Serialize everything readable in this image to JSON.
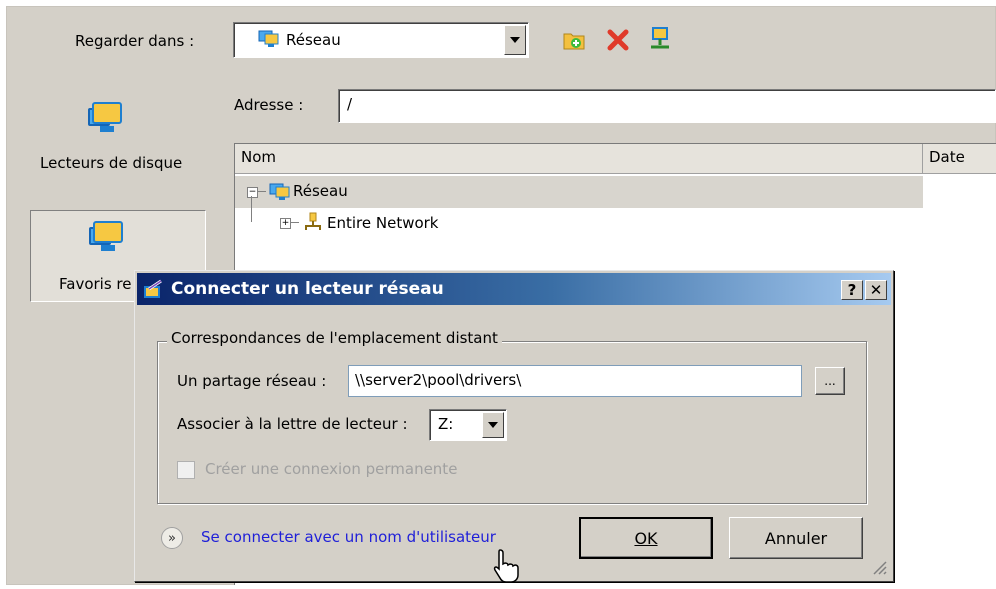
{
  "lookin": {
    "label": "Regarder dans :",
    "value": "Réseau"
  },
  "address": {
    "label": "Adresse :",
    "value": "/"
  },
  "places": [
    {
      "label": "Lecteurs de disque"
    },
    {
      "label": "Favoris re"
    }
  ],
  "list": {
    "columns": [
      "Nom",
      "Date"
    ],
    "tree": [
      {
        "label": "Réseau",
        "expander": "−"
      },
      {
        "label": "Entire Network",
        "expander": "+"
      }
    ]
  },
  "toolbar_icons": [
    "new-folder-icon",
    "delete-icon",
    "network-icon"
  ],
  "dialog": {
    "title": "Connecter un lecteur réseau",
    "help_button": "?",
    "close_button": "✕",
    "group_label": "Correspondances de l'emplacement distant",
    "share_label": "Un partage réseau :",
    "share_value": "\\\\server2\\pool\\drivers\\",
    "browse_label": "...",
    "drive_label": "Associer à la lettre de lecteur :",
    "drive_value": "Z:",
    "persist_label": "Créer une connexion permanente",
    "persist_checked": false,
    "user_link": "Se connecter avec un nom d'utilisateur",
    "ok_label": "OK",
    "cancel_label": "Annuler"
  },
  "colors": {
    "title_gradient_start": "#0a246a",
    "title_gradient_end": "#a6caf0",
    "link": "#1f1fd8",
    "panel": "#d4d0c8"
  }
}
